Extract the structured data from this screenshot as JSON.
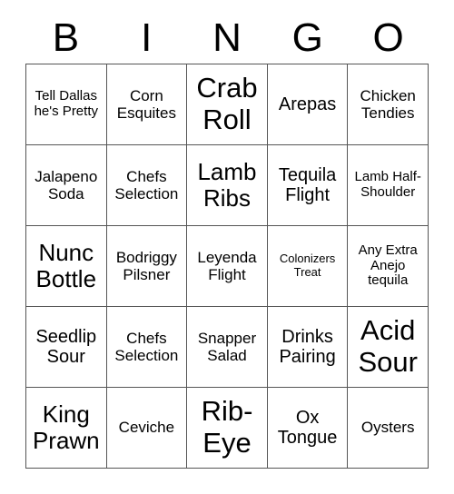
{
  "header": {
    "letters": [
      "B",
      "I",
      "N",
      "G",
      "O"
    ]
  },
  "grid": {
    "rows": 5,
    "columns": 5,
    "border_color": "#555555",
    "background_color": "#ffffff",
    "text_color": "#000000",
    "cells": [
      {
        "text": "Tell Dallas he's Pretty",
        "size": "sm"
      },
      {
        "text": "Corn Esquites",
        "size": "md"
      },
      {
        "text": "Crab Roll",
        "size": "xxl"
      },
      {
        "text": "Arepas",
        "size": "lg"
      },
      {
        "text": "Chicken Tendies",
        "size": "md"
      },
      {
        "text": "Jalapeno Soda",
        "size": "md"
      },
      {
        "text": "Chefs Selection",
        "size": "md"
      },
      {
        "text": "Lamb Ribs",
        "size": "xl"
      },
      {
        "text": "Tequila Flight",
        "size": "lg"
      },
      {
        "text": "Lamb Half-Shoulder",
        "size": "sm"
      },
      {
        "text": "Nunc Bottle",
        "size": "xl"
      },
      {
        "text": "Bodriggy Pilsner",
        "size": "md"
      },
      {
        "text": "Leyenda Flight",
        "size": "md"
      },
      {
        "text": "Colonizers Treat",
        "size": "xs"
      },
      {
        "text": "Any Extra Anejo tequila",
        "size": "sm"
      },
      {
        "text": "Seedlip Sour",
        "size": "lg"
      },
      {
        "text": "Chefs Selection",
        "size": "md"
      },
      {
        "text": "Snapper Salad",
        "size": "md"
      },
      {
        "text": "Drinks Pairing",
        "size": "lg"
      },
      {
        "text": "Acid Sour",
        "size": "xxl"
      },
      {
        "text": "King Prawn",
        "size": "xl"
      },
      {
        "text": "Ceviche",
        "size": "md"
      },
      {
        "text": "Rib-Eye",
        "size": "xxl"
      },
      {
        "text": "Ox Tongue",
        "size": "lg"
      },
      {
        "text": "Oysters",
        "size": "md"
      }
    ]
  }
}
